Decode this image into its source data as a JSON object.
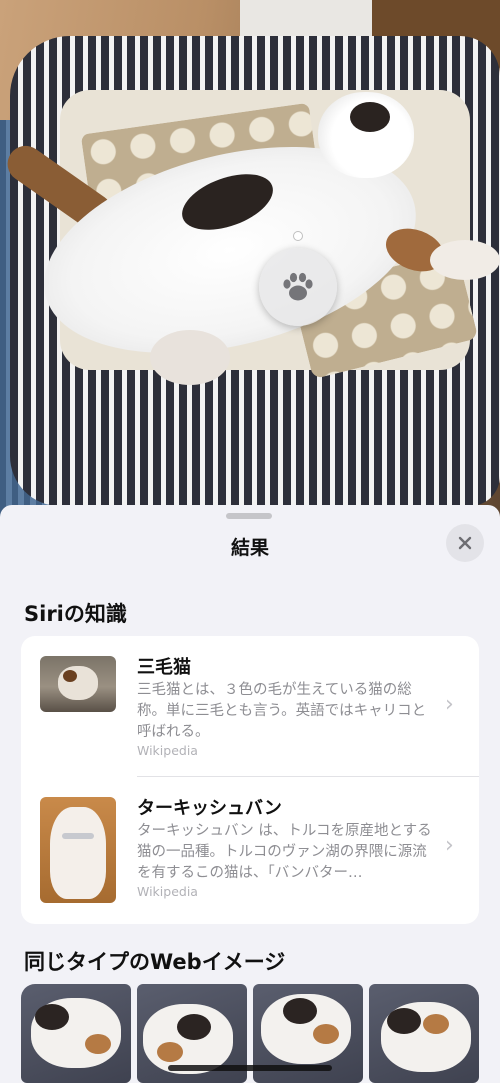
{
  "sheet": {
    "title": "結果",
    "close_icon": "close-icon"
  },
  "siri": {
    "section_title": "Siriの知識",
    "results": [
      {
        "name": "三毛猫",
        "description": "三毛猫とは、３色の毛が生えている猫の総称。単に三毛とも言う。英語ではキャリコと呼ばれる。",
        "source": "Wikipedia",
        "thumb_icon": "calico-cat-thumbnail"
      },
      {
        "name": "ターキッシュバン",
        "description": "ターキッシュバン は、トルコを原産地とする猫の一品種。トルコのヴァン湖の界隈に源流を有するこの猫は、「バンバター…",
        "source": "Wikipedia",
        "thumb_icon": "turkish-van-thumbnail"
      }
    ]
  },
  "web": {
    "section_title": "同じタイプのWebイメージ"
  },
  "photo": {
    "lookup_icon": "paw-icon"
  },
  "colors": {
    "sheet_bg": "#f2f2f7",
    "card_bg": "#ffffff",
    "secondary_text": "#8e8e93"
  }
}
